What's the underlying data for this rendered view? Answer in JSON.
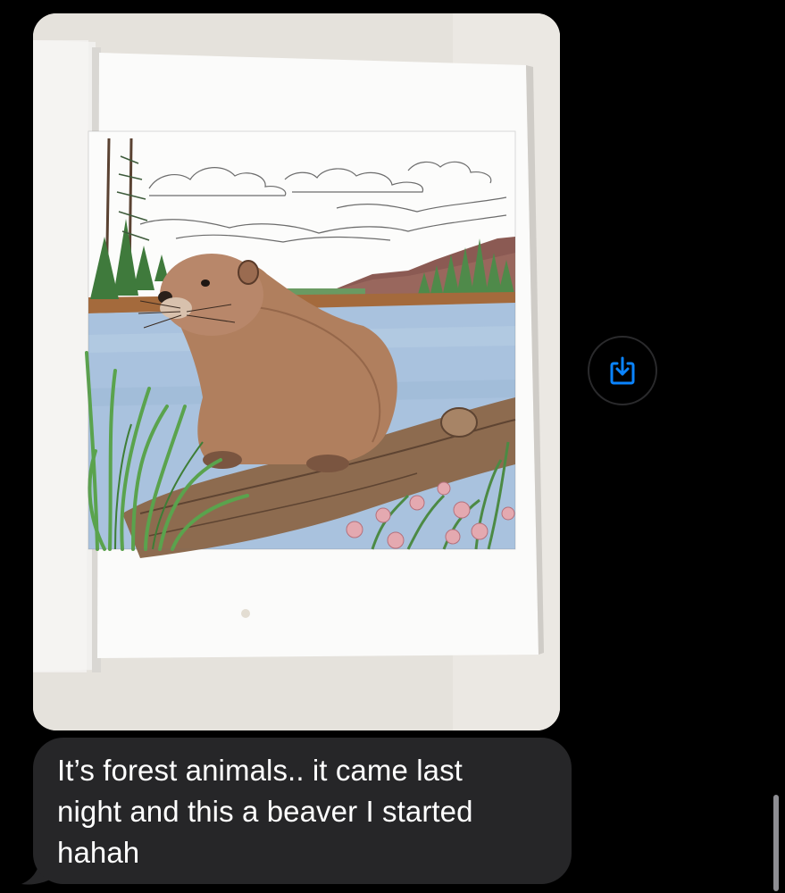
{
  "conversation": {
    "attachment": {
      "kind": "photo",
      "subject_icon": "beaver-coloring-page-photo"
    },
    "save_button": {
      "icon": "save-download-icon",
      "accent_color": "#0a84ff"
    },
    "message": {
      "text_line_1": "It’s forest animals.. it came last",
      "text_line_2": "night and this a beaver I started",
      "text_line_3": "hahah",
      "bubble_color": "#262628"
    }
  }
}
